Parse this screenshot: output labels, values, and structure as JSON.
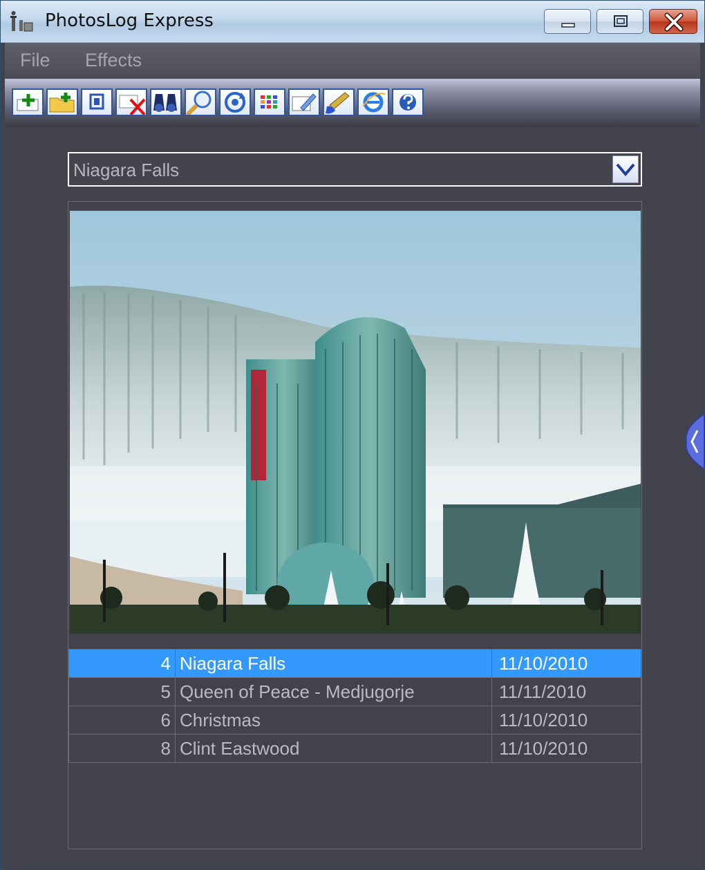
{
  "window": {
    "title": "PhotosLog Express",
    "minimize_icon": "minimize-icon",
    "maximize_icon": "restore-icon",
    "close_icon": "close-icon"
  },
  "menu": {
    "items": [
      {
        "label": "File"
      },
      {
        "label": "Effects"
      }
    ]
  },
  "toolbar": {
    "buttons": [
      {
        "icon": "add-photo-icon"
      },
      {
        "icon": "add-folder-icon"
      },
      {
        "icon": "frame-icon"
      },
      {
        "icon": "delete-icon"
      },
      {
        "icon": "binoculars-icon"
      },
      {
        "icon": "magnifier-icon"
      },
      {
        "icon": "rotate-icon"
      },
      {
        "icon": "thumbnails-grid-icon"
      },
      {
        "icon": "edit-icon"
      },
      {
        "icon": "paint-brush-icon"
      },
      {
        "icon": "internet-explorer-icon"
      },
      {
        "icon": "help-icon"
      }
    ]
  },
  "album": {
    "selected": "Niagara Falls"
  },
  "photos": {
    "rows": [
      {
        "id": "4",
        "name": "Niagara Falls",
        "date": "11/10/2010",
        "selected": true
      },
      {
        "id": "5",
        "name": "Queen of Peace - Medjugorje",
        "date": "11/11/2010",
        "selected": false
      },
      {
        "id": "6",
        "name": "Christmas",
        "date": "11/10/2010",
        "selected": false
      },
      {
        "id": "8",
        "name": "Clint Eastwood",
        "date": "11/10/2010",
        "selected": false
      }
    ]
  },
  "colors": {
    "selection": "#3399ff",
    "background": "#41424b"
  }
}
